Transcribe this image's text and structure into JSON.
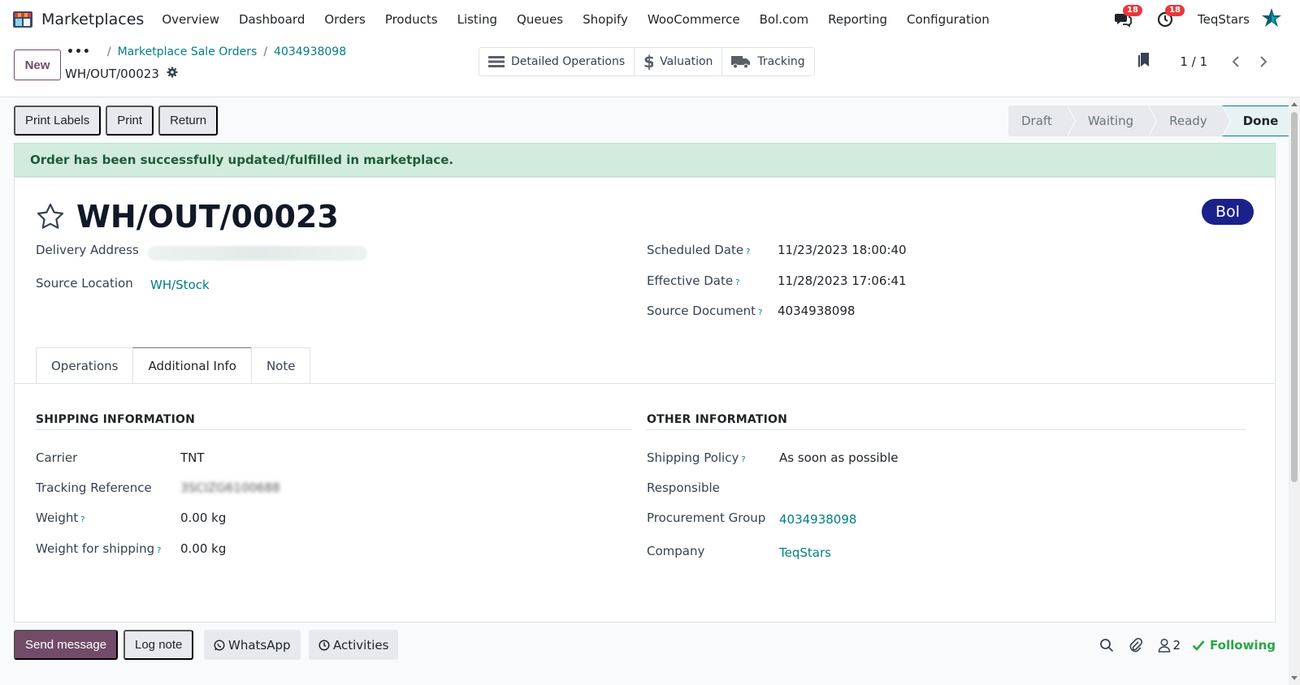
{
  "nav": {
    "app_title": "Marketplaces",
    "menu": [
      "Overview",
      "Dashboard",
      "Orders",
      "Products",
      "Listing",
      "Queues",
      "Shopify",
      "WooCommerce",
      "Bol.com",
      "Reporting",
      "Configuration"
    ],
    "messages_count": "18",
    "activities_count": "18",
    "company": "TeqStars"
  },
  "control": {
    "new_label": "New",
    "breadcrumb_dots": "•••",
    "breadcrumb_sep": "/",
    "breadcrumb": [
      "Marketplace Sale Orders",
      "4034938098"
    ],
    "record_name": "WH/OUT/00023",
    "smart_buttons": [
      "Detailed Operations",
      "Valuation",
      "Tracking"
    ],
    "pager": "1 / 1"
  },
  "statusbar": {
    "actions": [
      "Print Labels",
      "Print",
      "Return"
    ],
    "stages": [
      "Draft",
      "Waiting",
      "Ready",
      "Done"
    ],
    "active_stage": "Done"
  },
  "alert": "Order has been successfully updated/fulfilled in marketplace.",
  "sheet": {
    "title": "WH/OUT/00023",
    "tag": "Bol",
    "help_mark": "?",
    "delivery_address_label": "Delivery Address",
    "source_location_label": "Source Location",
    "source_location": "WH/Stock",
    "scheduled_date_label": "Scheduled Date",
    "scheduled_date": "11/23/2023 18:00:40",
    "effective_date_label": "Effective Date",
    "effective_date": "11/28/2023 17:06:41",
    "source_document_label": "Source Document",
    "source_document": "4034938098",
    "tabs": [
      "Operations",
      "Additional Info",
      "Note"
    ],
    "active_tab": "Additional Info",
    "shipping": {
      "title": "SHIPPING INFORMATION",
      "carrier_label": "Carrier",
      "carrier": "TNT",
      "tracking_label": "Tracking Reference",
      "tracking": "3SCIZG6100688",
      "weight_label": "Weight",
      "weight": "0.00 kg",
      "weight_ship_label": "Weight for shipping",
      "weight_ship": "0.00 kg"
    },
    "other": {
      "title": "OTHER INFORMATION",
      "policy_label": "Shipping Policy",
      "policy": "As soon as possible",
      "responsible_label": "Responsible",
      "procurement_label": "Procurement Group",
      "procurement": "4034938098",
      "company_label": "Company",
      "company": "TeqStars"
    }
  },
  "chatter": {
    "send_message": "Send message",
    "log_note": "Log note",
    "whatsapp": "WhatsApp",
    "activities": "Activities",
    "followers_count": "2",
    "following": "Following"
  },
  "colors": {
    "brand": "#714b67",
    "link": "#017e84",
    "success_bg": "#d1ecdd",
    "bol_badge": "#1a2189",
    "badge_red": "#e9373b"
  }
}
